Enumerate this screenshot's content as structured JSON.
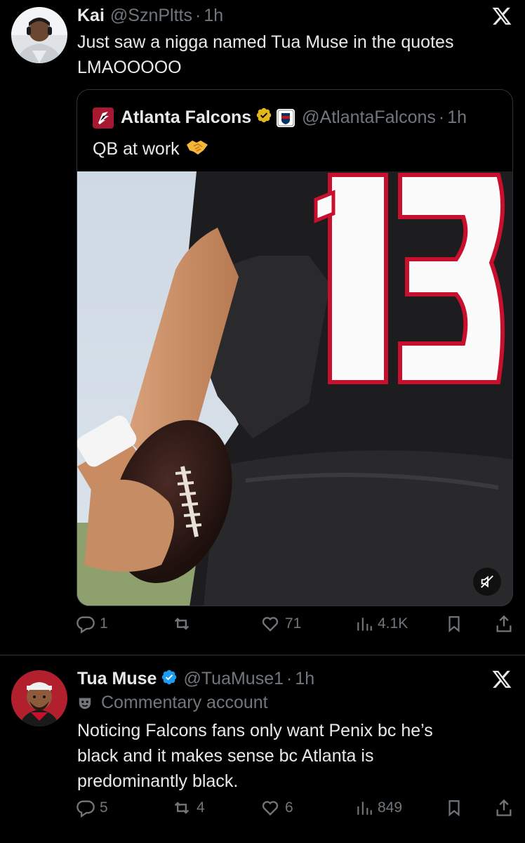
{
  "tweet1": {
    "name": "Kai",
    "handle": "@SznPltts",
    "sep": "·",
    "time": "1h",
    "text_line1": "Just saw a nigga named Tua Muse in the quotes",
    "text_line2": "LMAOOOOO",
    "quote": {
      "name": "Atlanta Falcons",
      "handle": "@AtlantaFalcons",
      "sep": "·",
      "time": "1h",
      "text": "QB at work",
      "emoji": "handshake-emoji",
      "media": {
        "jersey_number": "13",
        "type": "video",
        "muted": true
      }
    },
    "actions": {
      "replies": "1",
      "reposts": "",
      "likes": "71",
      "views": "4.1K"
    }
  },
  "tweet2": {
    "name": "Tua Muse",
    "handle": "@TuaMuse1",
    "sep": "·",
    "time": "1h",
    "label": "Commentary account",
    "text_line1": "Noticing Falcons fans only want Penix bc he’s",
    "text_line2": "black and it makes sense bc Atlanta is",
    "text_line3": "predominantly black.",
    "actions": {
      "replies": "5",
      "reposts": "4",
      "likes": "6",
      "views": "849"
    }
  },
  "colors": {
    "background": "#000000",
    "text": "#e7e9ea",
    "muted": "#71767b",
    "verified_blue": "#1d9bf0",
    "verified_gold": "#e2b719",
    "falcons_red": "#a71930"
  },
  "icons": [
    "x-logo-icon",
    "verified-icon",
    "reply-icon",
    "repost-icon",
    "like-icon",
    "views-icon",
    "bookmark-icon",
    "share-icon",
    "mute-icon",
    "mask-icon"
  ]
}
